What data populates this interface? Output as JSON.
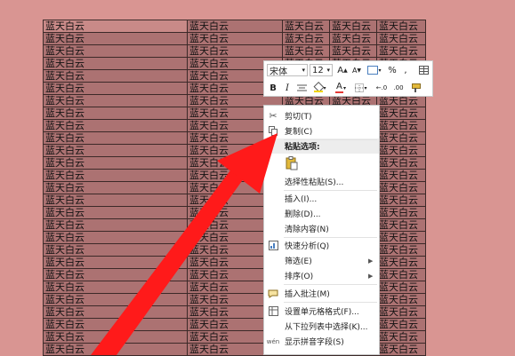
{
  "sheet": {
    "cell_text": "蓝天白云",
    "rows": 27
  },
  "mini_toolbar": {
    "font_name": "宋体",
    "font_size": "12",
    "increase_font": "A",
    "decrease_font": "A",
    "currency": "%",
    "comma": ",",
    "bold": "B",
    "italic": "I",
    "font_color_letter": "A",
    "accent_color": "#e53935",
    "fill_color": "#f2d600"
  },
  "context_menu": {
    "items": [
      {
        "icon": "scissors-icon",
        "label": "剪切(T)"
      },
      {
        "icon": "copy-icon",
        "label": "复制(C)"
      },
      {
        "icon": "",
        "label": "粘贴选项:"
      },
      {
        "icon": "paste-icon",
        "label": ""
      },
      {
        "icon": "",
        "label": "选择性粘贴(S)..."
      },
      {
        "icon": "",
        "label": "插入(I)..."
      },
      {
        "icon": "",
        "label": "删除(D)..."
      },
      {
        "icon": "",
        "label": "清除内容(N)"
      },
      {
        "icon": "quick-analysis-icon",
        "label": "快速分析(Q)"
      },
      {
        "icon": "",
        "label": "筛选(E)"
      },
      {
        "icon": "",
        "label": "排序(O)"
      },
      {
        "icon": "comment-icon",
        "label": "插入批注(M)"
      },
      {
        "icon": "format-cells-icon",
        "label": "设置单元格格式(F)..."
      },
      {
        "icon": "",
        "label": "从下拉列表中选择(K)..."
      },
      {
        "icon": "phonetic-icon",
        "label": "显示拼音字段(S)"
      }
    ]
  },
  "colors": {
    "page_bg": "#d99592",
    "arrow": "#ff1a1a"
  }
}
